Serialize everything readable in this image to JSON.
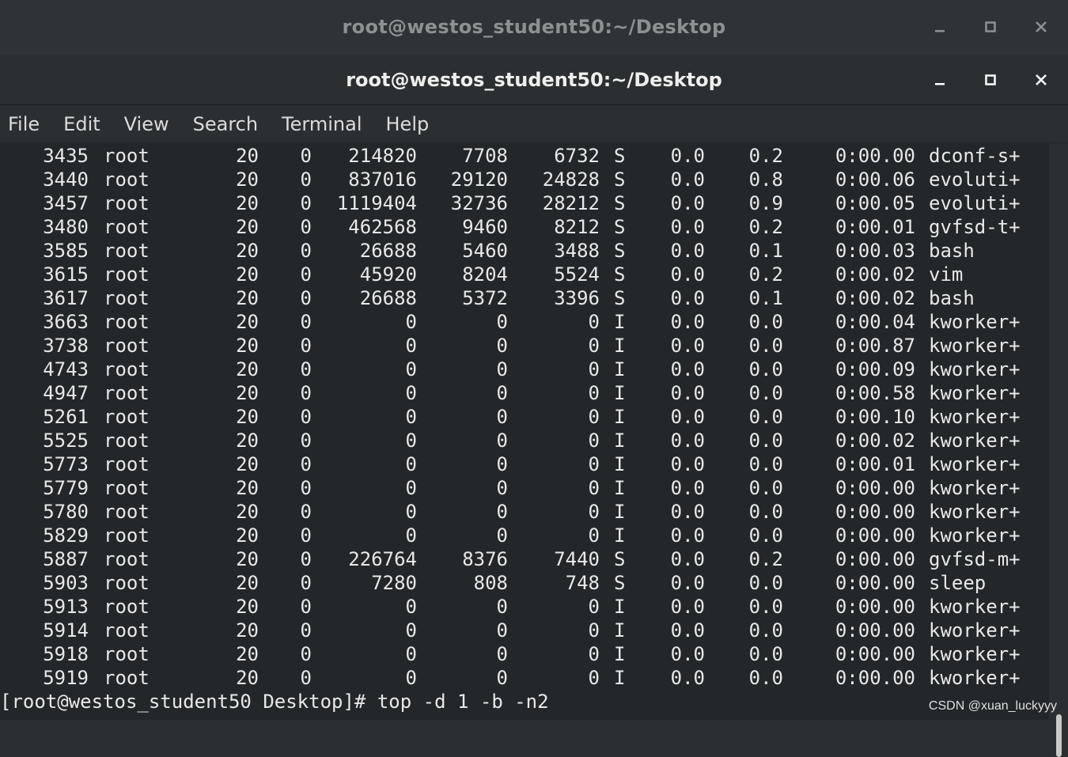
{
  "background_window": {
    "title": "root@westos_student50:~/Desktop"
  },
  "window": {
    "title": "root@westos_student50:~/Desktop"
  },
  "menu": [
    "File",
    "Edit",
    "View",
    "Search",
    "Terminal",
    "Help"
  ],
  "process_rows": [
    [
      "3435",
      "root",
      "20",
      "0",
      "214820",
      "7708",
      "6732",
      "S",
      "0.0",
      "0.2",
      "0:00.00",
      "dconf-s+"
    ],
    [
      "3440",
      "root",
      "20",
      "0",
      "837016",
      "29120",
      "24828",
      "S",
      "0.0",
      "0.8",
      "0:00.06",
      "evoluti+"
    ],
    [
      "3457",
      "root",
      "20",
      "0",
      "1119404",
      "32736",
      "28212",
      "S",
      "0.0",
      "0.9",
      "0:00.05",
      "evoluti+"
    ],
    [
      "3480",
      "root",
      "20",
      "0",
      "462568",
      "9460",
      "8212",
      "S",
      "0.0",
      "0.2",
      "0:00.01",
      "gvfsd-t+"
    ],
    [
      "3585",
      "root",
      "20",
      "0",
      "26688",
      "5460",
      "3488",
      "S",
      "0.0",
      "0.1",
      "0:00.03",
      "bash"
    ],
    [
      "3615",
      "root",
      "20",
      "0",
      "45920",
      "8204",
      "5524",
      "S",
      "0.0",
      "0.2",
      "0:00.02",
      "vim"
    ],
    [
      "3617",
      "root",
      "20",
      "0",
      "26688",
      "5372",
      "3396",
      "S",
      "0.0",
      "0.1",
      "0:00.02",
      "bash"
    ],
    [
      "3663",
      "root",
      "20",
      "0",
      "0",
      "0",
      "0",
      "I",
      "0.0",
      "0.0",
      "0:00.04",
      "kworker+"
    ],
    [
      "3738",
      "root",
      "20",
      "0",
      "0",
      "0",
      "0",
      "I",
      "0.0",
      "0.0",
      "0:00.87",
      "kworker+"
    ],
    [
      "4743",
      "root",
      "20",
      "0",
      "0",
      "0",
      "0",
      "I",
      "0.0",
      "0.0",
      "0:00.09",
      "kworker+"
    ],
    [
      "4947",
      "root",
      "20",
      "0",
      "0",
      "0",
      "0",
      "I",
      "0.0",
      "0.0",
      "0:00.58",
      "kworker+"
    ],
    [
      "5261",
      "root",
      "20",
      "0",
      "0",
      "0",
      "0",
      "I",
      "0.0",
      "0.0",
      "0:00.10",
      "kworker+"
    ],
    [
      "5525",
      "root",
      "20",
      "0",
      "0",
      "0",
      "0",
      "I",
      "0.0",
      "0.0",
      "0:00.02",
      "kworker+"
    ],
    [
      "5773",
      "root",
      "20",
      "0",
      "0",
      "0",
      "0",
      "I",
      "0.0",
      "0.0",
      "0:00.01",
      "kworker+"
    ],
    [
      "5779",
      "root",
      "20",
      "0",
      "0",
      "0",
      "0",
      "I",
      "0.0",
      "0.0",
      "0:00.00",
      "kworker+"
    ],
    [
      "5780",
      "root",
      "20",
      "0",
      "0",
      "0",
      "0",
      "I",
      "0.0",
      "0.0",
      "0:00.00",
      "kworker+"
    ],
    [
      "5829",
      "root",
      "20",
      "0",
      "0",
      "0",
      "0",
      "I",
      "0.0",
      "0.0",
      "0:00.00",
      "kworker+"
    ],
    [
      "5887",
      "root",
      "20",
      "0",
      "226764",
      "8376",
      "7440",
      "S",
      "0.0",
      "0.2",
      "0:00.00",
      "gvfsd-m+"
    ],
    [
      "5903",
      "root",
      "20",
      "0",
      "7280",
      "808",
      "748",
      "S",
      "0.0",
      "0.0",
      "0:00.00",
      "sleep"
    ],
    [
      "5913",
      "root",
      "20",
      "0",
      "0",
      "0",
      "0",
      "I",
      "0.0",
      "0.0",
      "0:00.00",
      "kworker+"
    ],
    [
      "5914",
      "root",
      "20",
      "0",
      "0",
      "0",
      "0",
      "I",
      "0.0",
      "0.0",
      "0:00.00",
      "kworker+"
    ],
    [
      "5918",
      "root",
      "20",
      "0",
      "0",
      "0",
      "0",
      "I",
      "0.0",
      "0.0",
      "0:00.00",
      "kworker+"
    ],
    [
      "5919",
      "root",
      "20",
      "0",
      "0",
      "0",
      "0",
      "I",
      "0.0",
      "0.0",
      "0:00.00",
      "kworker+"
    ]
  ],
  "prompt": "[root@westos_student50 Desktop]# top -d 1 -b -n2",
  "watermark": "CSDN @xuan_luckyyy",
  "colors": {
    "terminal_bg": "#232729",
    "text": "#e8e8e8"
  }
}
